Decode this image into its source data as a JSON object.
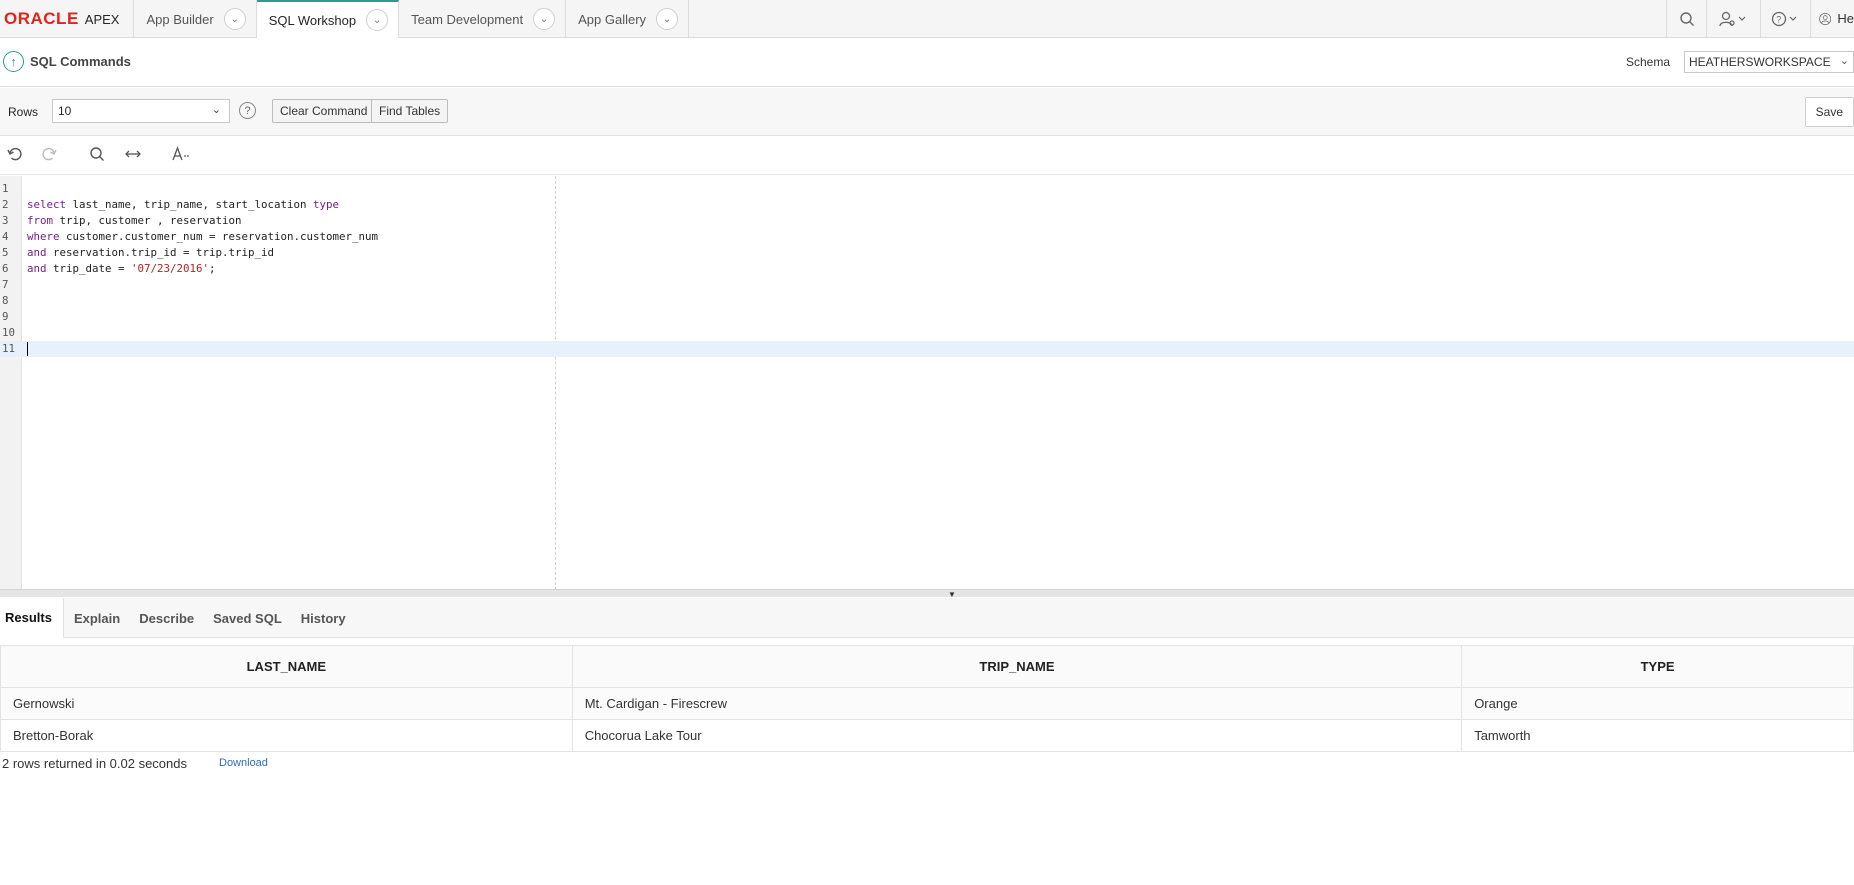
{
  "brand": {
    "oracle": "ORACLE",
    "apex": "APEX"
  },
  "nav": {
    "tabs": [
      {
        "label": "App Builder"
      },
      {
        "label": "SQL Workshop"
      },
      {
        "label": "Team Development"
      },
      {
        "label": "App Gallery"
      }
    ],
    "user_partial": "He"
  },
  "header": {
    "title": "SQL Commands",
    "schema_label": "Schema",
    "schema_value": "HEATHERSWORKSPACE"
  },
  "toolbar": {
    "rows_label": "Rows",
    "rows_value": "10",
    "help": "?",
    "clear_command": "Clear Command",
    "find_tables": "Find Tables",
    "save": "Save"
  },
  "editor": {
    "line_numbers": [
      "1",
      "2",
      "3",
      "4",
      "5",
      "6",
      "7",
      "8",
      "9",
      "10",
      "11"
    ],
    "lines": [
      "",
      "select last_name, trip_name, start_location type",
      "from trip, customer , reservation",
      "where customer.customer_num = reservation.customer_num",
      "and reservation.trip_id = trip.trip_id",
      "and trip_date = '07/23/2016';",
      "",
      "",
      "",
      "",
      ""
    ]
  },
  "result_tabs": [
    {
      "label": "Results"
    },
    {
      "label": "Explain"
    },
    {
      "label": "Describe"
    },
    {
      "label": "Saved SQL"
    },
    {
      "label": "History"
    }
  ],
  "results": {
    "columns": [
      "LAST_NAME",
      "TRIP_NAME",
      "TYPE"
    ],
    "rows": [
      [
        "Gernowski",
        "Mt. Cardigan - Firescrew",
        "Orange"
      ],
      [
        "Bretton-Borak",
        "Chocorua Lake Tour",
        "Tamworth"
      ]
    ],
    "summary": "2 rows returned in 0.02 seconds",
    "download": "Download"
  },
  "colors": {
    "oracle_red": "#e2231a",
    "accent": "#2a9d8f",
    "keyword": "#7a1e8c",
    "string": "#b22222",
    "link": "#2e6db5"
  }
}
